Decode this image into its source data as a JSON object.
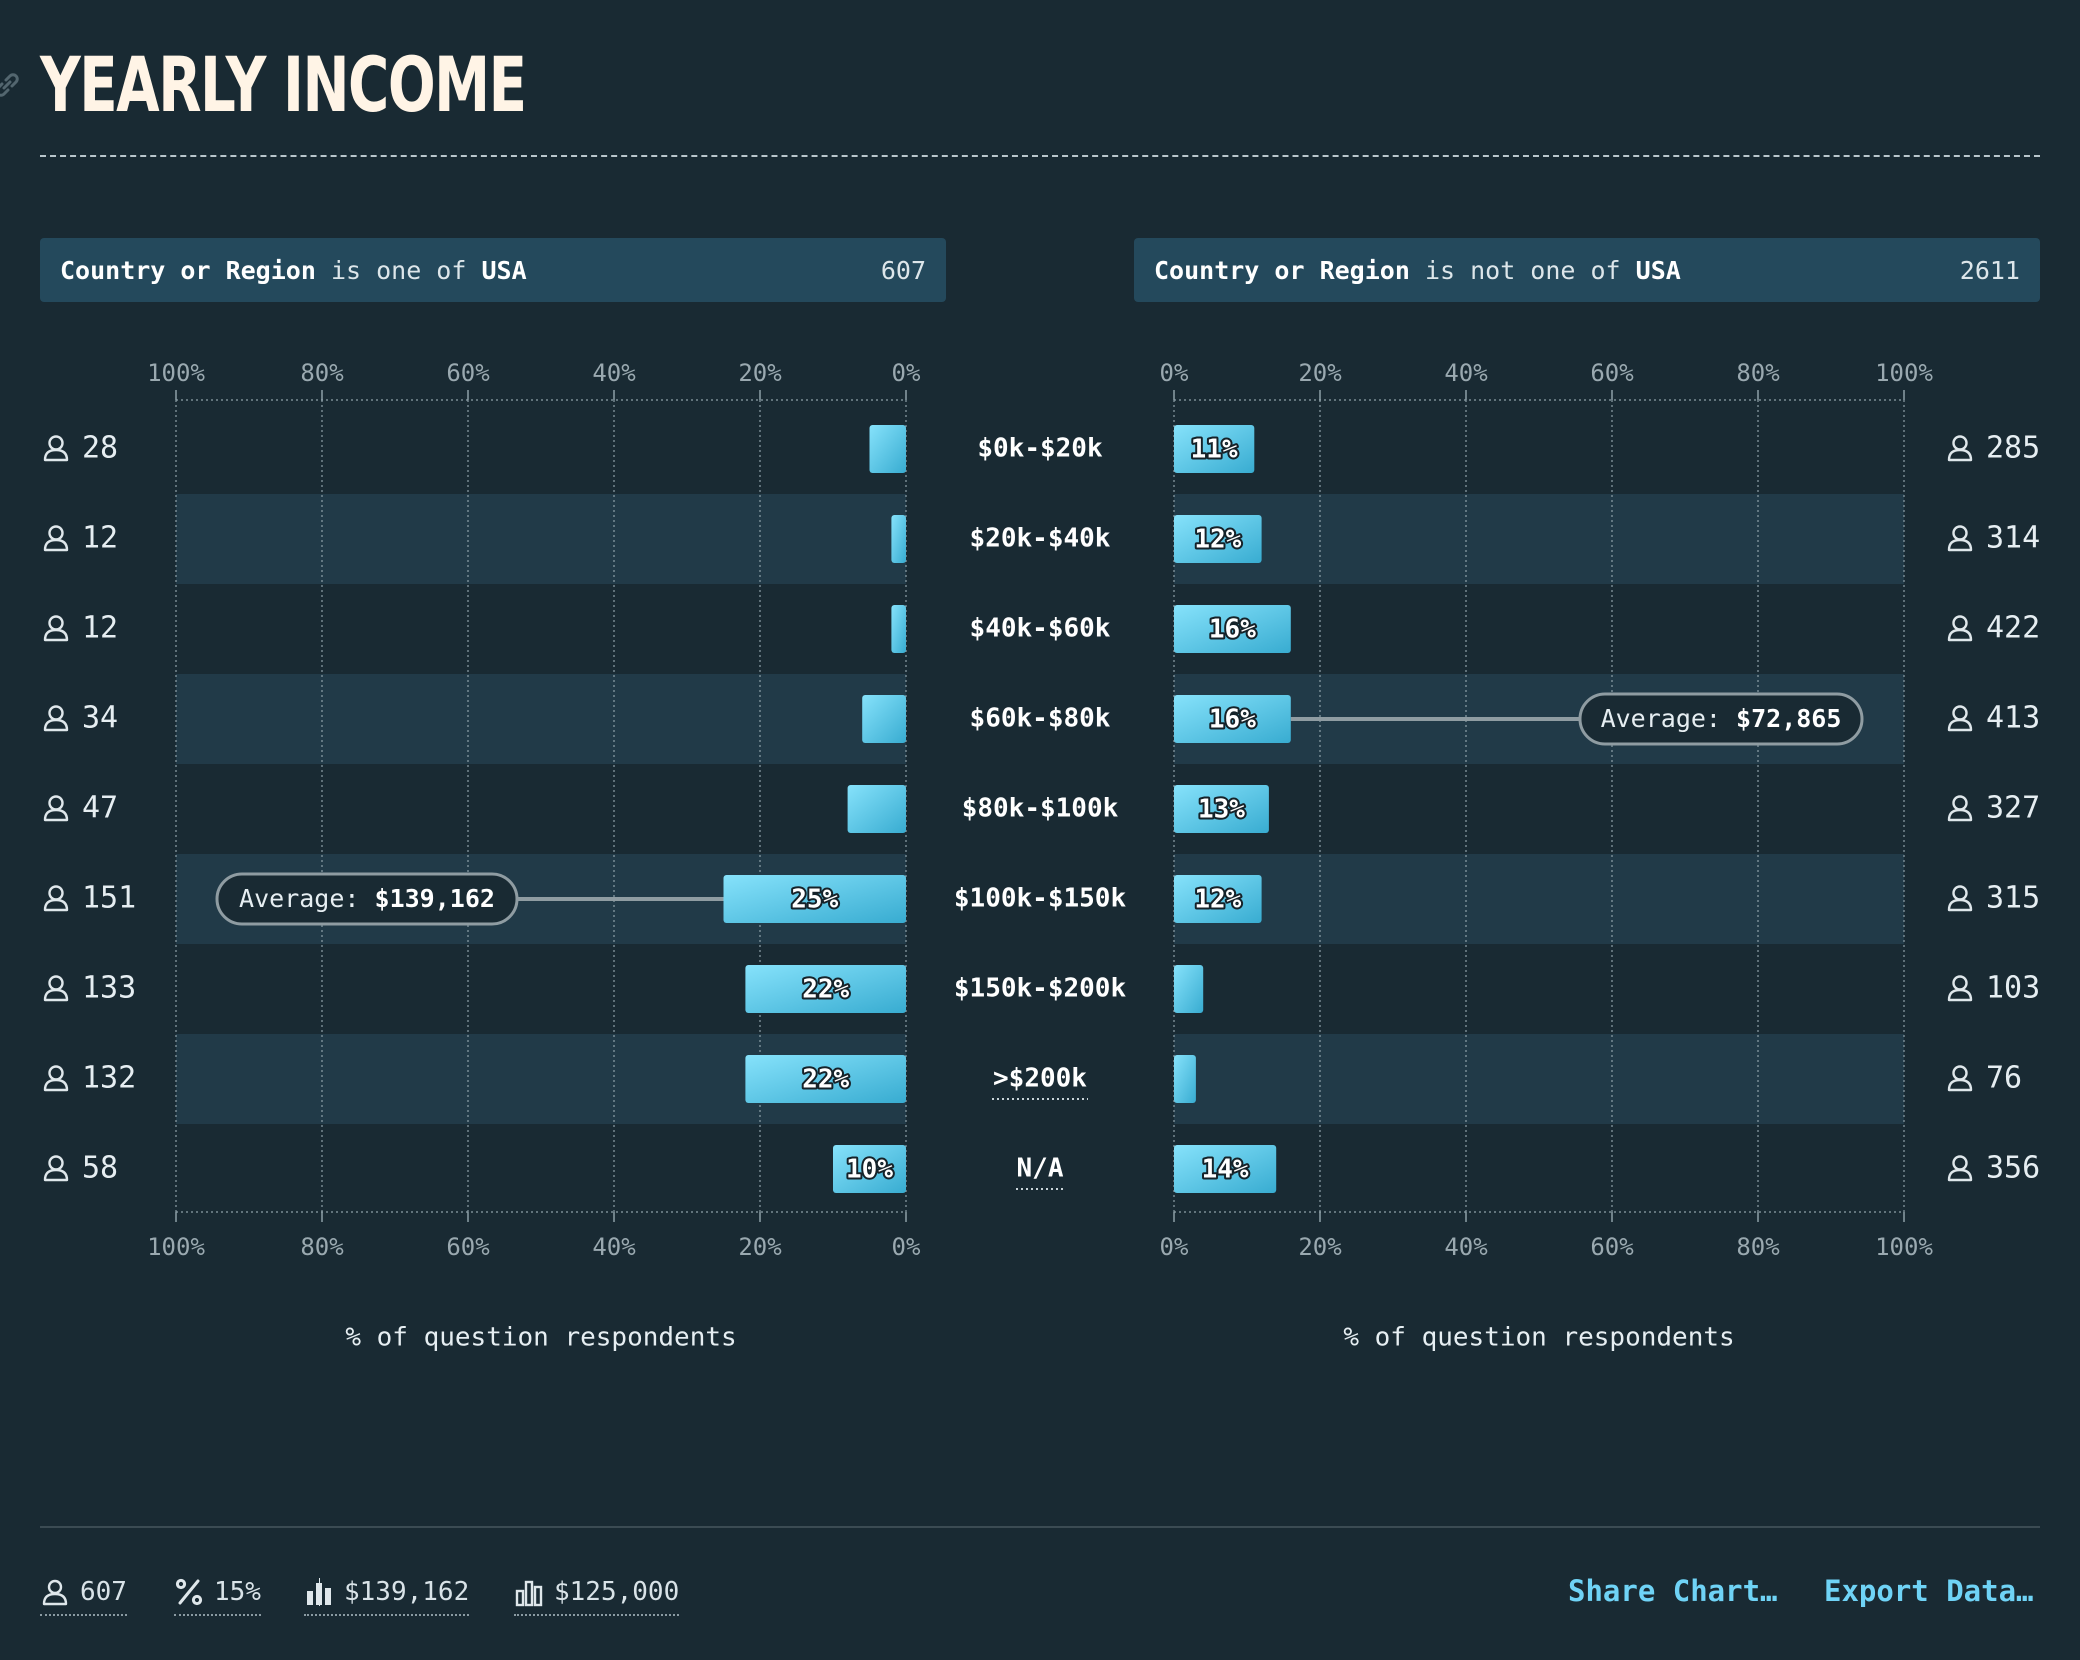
{
  "title": "YEARLY INCOME",
  "filters": {
    "left": {
      "field": "Country or Region",
      "op": "is one of",
      "value": "USA",
      "count": "607"
    },
    "right": {
      "field": "Country or Region",
      "op": "is not one of",
      "value": "USA",
      "count": "2611"
    }
  },
  "colors": {
    "background": "#192a33",
    "bar_light": "#7fdcf9",
    "bar_dark": "#3fb3d6",
    "band": "#213a48",
    "accent": "#6fd3f6"
  },
  "chart_data": [
    {
      "type": "bar",
      "orientation": "horizontal",
      "direction": "right-to-left",
      "categories": [
        "$0k-$20k",
        "$20k-$40k",
        "$40k-$60k",
        "$60k-$80k",
        "$80k-$100k",
        "$100k-$150k",
        "$150k-$200k",
        ">$200k",
        "N/A"
      ],
      "values": [
        5,
        2,
        2,
        6,
        8,
        25,
        22,
        22,
        10
      ],
      "value_labels": [
        "",
        "",
        "",
        "",
        "",
        "25%",
        "22%",
        "22%",
        "10%"
      ],
      "respondents": [
        "28",
        "12",
        "12",
        "34",
        "47",
        "151",
        "133",
        "132",
        "58"
      ],
      "xlim": [
        0,
        100
      ],
      "ticks": [
        "100%",
        "80%",
        "60%",
        "40%",
        "20%",
        "0%"
      ],
      "xlabel": "% of question respondents",
      "average": {
        "label": "Average:",
        "value": "$139,162",
        "category_index": 5
      }
    },
    {
      "type": "bar",
      "orientation": "horizontal",
      "direction": "left-to-right",
      "categories": [
        "$0k-$20k",
        "$20k-$40k",
        "$40k-$60k",
        "$60k-$80k",
        "$80k-$100k",
        "$100k-$150k",
        "$150k-$200k",
        ">$200k",
        "N/A"
      ],
      "values": [
        11,
        12,
        16,
        16,
        13,
        12,
        4,
        3,
        14
      ],
      "value_labels": [
        "11%",
        "12%",
        "16%",
        "16%",
        "13%",
        "12%",
        "",
        "",
        "14%"
      ],
      "respondents": [
        "285",
        "314",
        "422",
        "413",
        "327",
        "315",
        "103",
        "76",
        "356"
      ],
      "xlim": [
        0,
        100
      ],
      "ticks": [
        "0%",
        "20%",
        "40%",
        "60%",
        "80%",
        "100%"
      ],
      "xlabel": "% of question respondents",
      "average": {
        "label": "Average:",
        "value": "$72,865",
        "category_index": 3
      }
    }
  ],
  "footer": {
    "stats": [
      {
        "icon": "person-icon",
        "value": "607"
      },
      {
        "icon": "percent-icon",
        "value": "15%"
      },
      {
        "icon": "average-bars-icon",
        "value": "$139,162"
      },
      {
        "icon": "median-bars-icon",
        "value": "$125,000"
      }
    ],
    "share_label": "Share Chart…",
    "export_label": "Export Data…"
  }
}
